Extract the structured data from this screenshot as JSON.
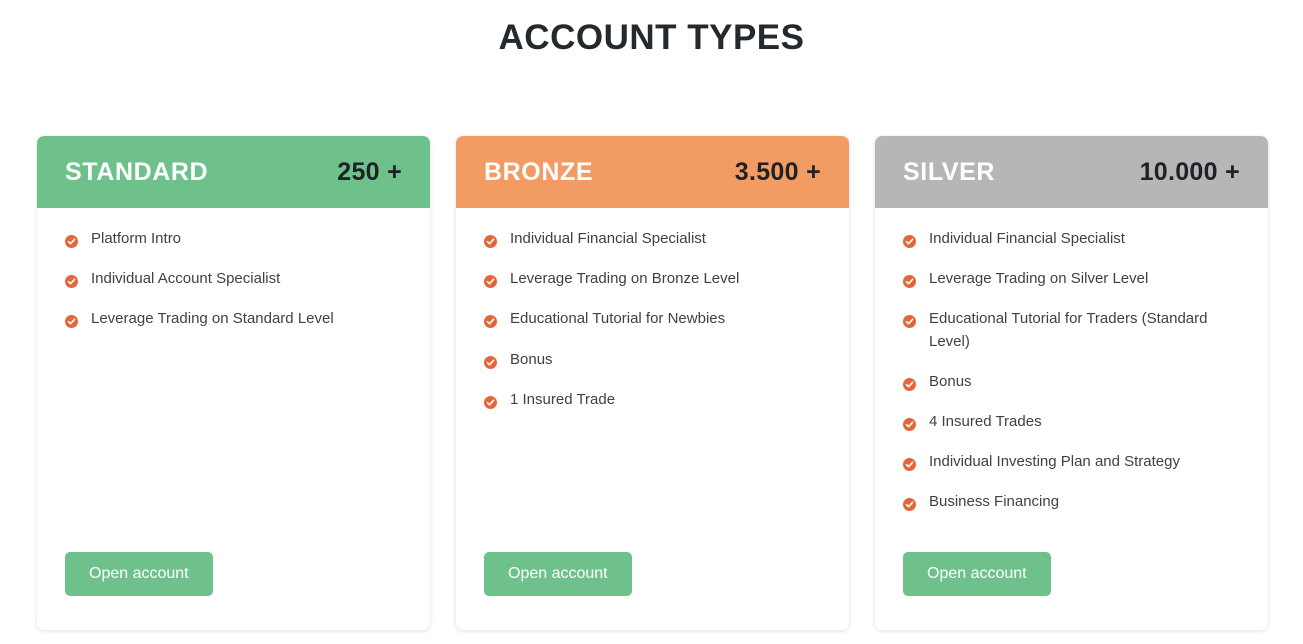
{
  "page": {
    "title": "ACCOUNT TYPES",
    "background_color": "#ffffff",
    "title_color": "#24292e"
  },
  "colors": {
    "standard_header": "#6ec18a",
    "bronze_header": "#f29b63",
    "silver_header": "#b6b6b6",
    "check_icon": "#e4673c",
    "button": "#6ec18a",
    "feature_text": "#3c4246",
    "price_text": "#1e2125"
  },
  "icons": {
    "check": "check-circle-icon"
  },
  "cards": [
    {
      "plan": "STANDARD",
      "price": "250 +",
      "header_style": "green",
      "button_label": "Open account",
      "features": [
        "Platform Intro",
        "Individual Account Specialist",
        "Leverage Trading on Standard Level"
      ]
    },
    {
      "plan": "BRONZE",
      "price": "3.500 +",
      "header_style": "orange",
      "button_label": "Open account",
      "features": [
        "Individual Financial Specialist",
        "Leverage Trading on Bronze Level",
        "Educational Tutorial for Newbies",
        "Bonus",
        "1 Insured Trade"
      ]
    },
    {
      "plan": "SILVER",
      "price": "10.000 +",
      "header_style": "gray",
      "button_label": "Open account",
      "features": [
        "Individual Financial Specialist",
        "Leverage Trading on Silver Level",
        "Educational Tutorial for Traders (Standard Level)",
        "Bonus",
        "4 Insured Trades",
        "Individual Investing Plan and Strategy",
        "Business Financing"
      ]
    }
  ]
}
